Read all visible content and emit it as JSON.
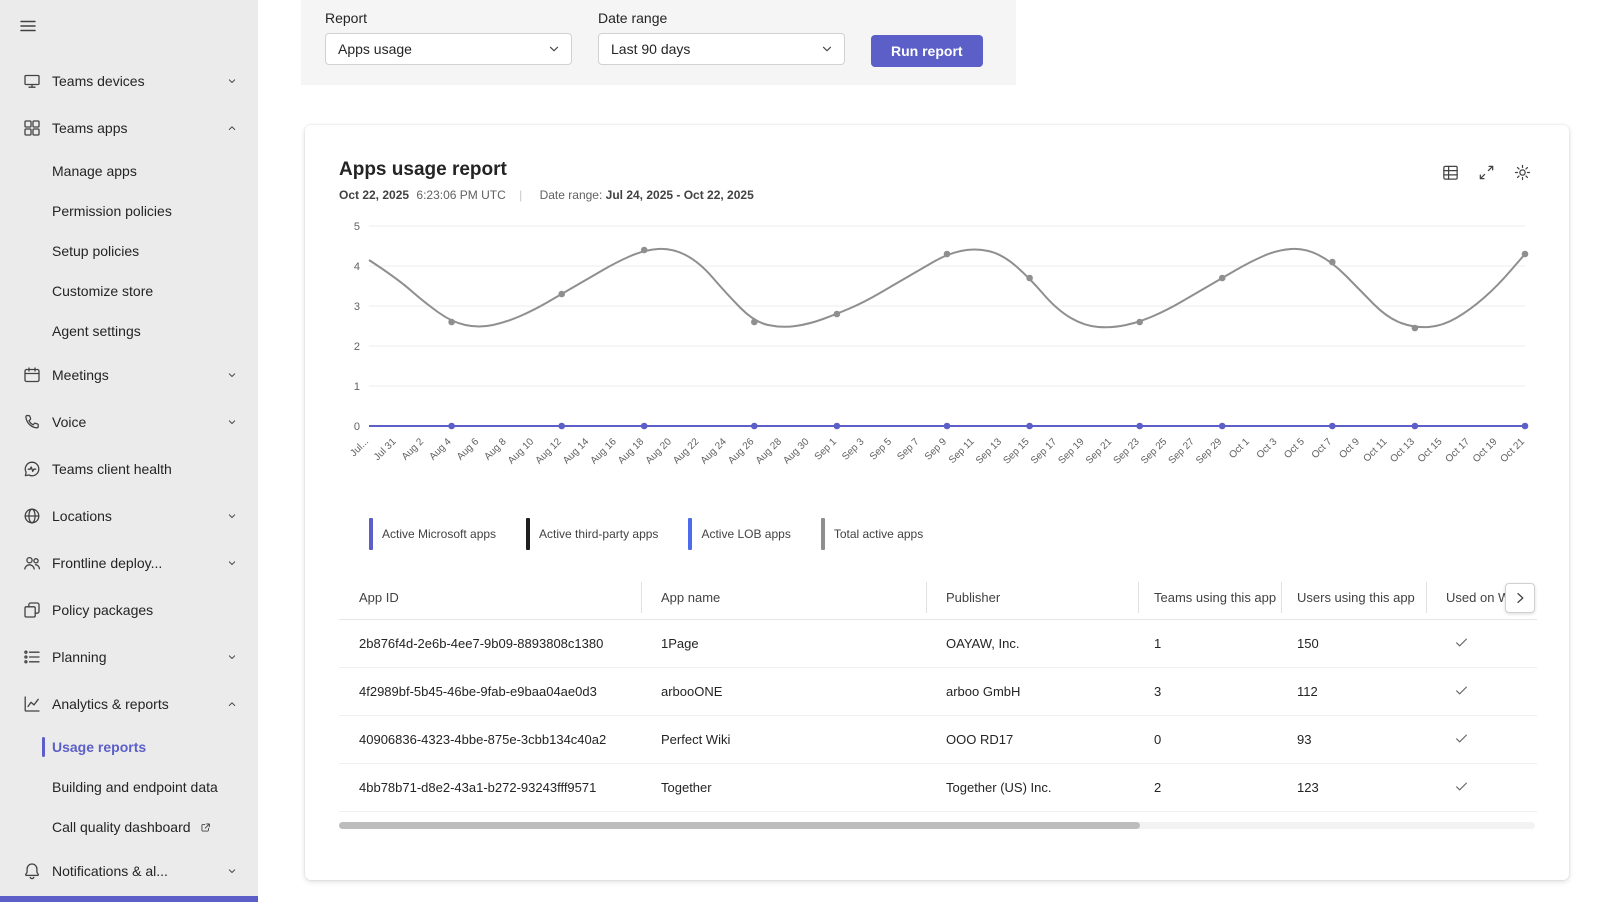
{
  "colors": {
    "accent": "#5b5fc7",
    "sidebar_bg": "#ebebeb",
    "filter_panel_bg": "#f5f5f5",
    "selected_item": "#5b5fc7",
    "scrollbar_thumb": "#bdbdbd"
  },
  "sidebar": {
    "items": [
      {
        "label": "Teams devices",
        "icon": "devices",
        "chevron": "down"
      },
      {
        "label": "Teams apps",
        "icon": "apps",
        "chevron": "up",
        "children": [
          {
            "label": "Manage apps"
          },
          {
            "label": "Permission policies"
          },
          {
            "label": "Setup policies"
          },
          {
            "label": "Customize store"
          },
          {
            "label": "Agent settings"
          }
        ]
      },
      {
        "label": "Meetings",
        "icon": "calendar",
        "chevron": "down"
      },
      {
        "label": "Voice",
        "icon": "phone",
        "chevron": "down"
      },
      {
        "label": "Teams client health",
        "icon": "health"
      },
      {
        "label": "Locations",
        "icon": "globe",
        "chevron": "down"
      },
      {
        "label": "Frontline deploy...",
        "icon": "people",
        "chevron": "down"
      },
      {
        "label": "Policy packages",
        "icon": "packages"
      },
      {
        "label": "Planning",
        "icon": "planning",
        "chevron": "down"
      },
      {
        "label": "Analytics & reports",
        "icon": "analytics",
        "chevron": "up",
        "children": [
          {
            "label": "Usage reports",
            "selected": true
          },
          {
            "label": "Building and endpoint data"
          },
          {
            "label": "Call quality dashboard",
            "external": true
          }
        ]
      },
      {
        "label": "Notifications & al...",
        "icon": "bell",
        "chevron": "down"
      }
    ]
  },
  "filters": {
    "report_label": "Report",
    "report_value": "Apps usage",
    "date_range_label": "Date range",
    "date_range_value": "Last 90 days",
    "run_button_label": "Run report"
  },
  "report": {
    "title": "Apps usage report",
    "generated_date": "Oct 22, 2025",
    "generated_time": "6:23:06 PM UTC",
    "separator": "|",
    "date_range_label": "Date range:",
    "date_range_value": "Jul 24, 2025 - Oct 22, 2025"
  },
  "card": {
    "actions": [
      {
        "name": "export-to-excel",
        "icon": "excel-icon"
      },
      {
        "name": "expand-report",
        "icon": "expand-icon"
      },
      {
        "name": "report-settings",
        "icon": "gear-icon"
      }
    ]
  },
  "chart_data": {
    "type": "line",
    "title": "Apps usage report",
    "xlabel": "",
    "ylabel": "",
    "ylim": [
      0,
      5
    ],
    "y_ticks": [
      0,
      1,
      2,
      3,
      4,
      5
    ],
    "grid": true,
    "legend_position": "bottom",
    "x_labels": [
      "Jul...",
      "Jul 31",
      "Aug 2",
      "Aug 4",
      "Aug 6",
      "Aug 8",
      "Aug 10",
      "Aug 12",
      "Aug 14",
      "Aug 16",
      "Aug 18",
      "Aug 20",
      "Aug 22",
      "Aug 24",
      "Aug 26",
      "Aug 28",
      "Aug 30",
      "Sep 1",
      "Sep 3",
      "Sep 5",
      "Sep 7",
      "Sep 9",
      "Sep 11",
      "Sep 13",
      "Sep 15",
      "Sep 17",
      "Sep 19",
      "Sep 21",
      "Sep 23",
      "Sep 25",
      "Sep 27",
      "Sep 29",
      "Oct 1",
      "Oct 3",
      "Oct 5",
      "Oct 7",
      "Oct 9",
      "Oct 11",
      "Oct 13",
      "Oct 15",
      "Oct 17",
      "Oct 19",
      "Oct 21"
    ],
    "series": [
      {
        "name": "Active Microsoft apps",
        "color": "#5b5fc7",
        "values": [
          0,
          0,
          0,
          0,
          0,
          0,
          0,
          0,
          0,
          0,
          0,
          0,
          0,
          0,
          0,
          0,
          0,
          0,
          0,
          0,
          0,
          0,
          0,
          0,
          0,
          0,
          0,
          0,
          0,
          0,
          0,
          0,
          0,
          0,
          0,
          0,
          0,
          0,
          0,
          0,
          0,
          0,
          0
        ]
      },
      {
        "name": "Active third-party apps",
        "color": "#1f1f1f",
        "values": [
          0,
          0,
          0,
          0,
          0,
          0,
          0,
          0,
          0,
          0,
          0,
          0,
          0,
          0,
          0,
          0,
          0,
          0,
          0,
          0,
          0,
          0,
          0,
          0,
          0,
          0,
          0,
          0,
          0,
          0,
          0,
          0,
          0,
          0,
          0,
          0,
          0,
          0,
          0,
          0,
          0,
          0,
          0
        ]
      },
      {
        "name": "Active LOB apps",
        "color": "#4f6bed",
        "values": [
          0,
          0,
          0,
          0,
          0,
          0,
          0,
          0,
          0,
          0,
          0,
          0,
          0,
          0,
          0,
          0,
          0,
          0,
          0,
          0,
          0,
          0,
          0,
          0,
          0,
          0,
          0,
          0,
          0,
          0,
          0,
          0,
          0,
          0,
          0,
          0,
          0,
          0,
          0,
          0,
          0,
          0,
          0
        ]
      },
      {
        "name": "Total active apps",
        "color": "#8f8f8f",
        "values": [
          4.15,
          3.7,
          3.1,
          2.6,
          2.45,
          2.6,
          2.9,
          3.3,
          3.7,
          4.1,
          4.4,
          4.45,
          4.1,
          3.3,
          2.6,
          2.45,
          2.55,
          2.8,
          3.1,
          3.5,
          3.9,
          4.3,
          4.45,
          4.3,
          3.7,
          2.9,
          2.5,
          2.45,
          2.6,
          2.9,
          3.3,
          3.7,
          4.1,
          4.4,
          4.45,
          4.1,
          3.4,
          2.7,
          2.45,
          2.5,
          2.9,
          3.5,
          4.3
        ]
      }
    ],
    "marker_indices": [
      3,
      7,
      10,
      14,
      17,
      21,
      24,
      28,
      31,
      35,
      38,
      42
    ]
  },
  "table": {
    "columns": [
      "App ID",
      "App name",
      "Publisher",
      "Teams using this app",
      "Users using this app",
      "Used on W"
    ],
    "rows": [
      {
        "app_id": "2b876f4d-2e6b-4ee7-9b09-8893808c1380",
        "app_name": "1Page",
        "publisher": "OAYAW, Inc.",
        "teams_using": "1",
        "users_using": "150",
        "used_on_windows": true
      },
      {
        "app_id": "4f2989bf-5b45-46be-9fab-e9baa04ae0d3",
        "app_name": "arbooONE",
        "publisher": "arboo GmbH",
        "teams_using": "3",
        "users_using": "112",
        "used_on_windows": true
      },
      {
        "app_id": "40906836-4323-4bbe-875e-3cbb134c40a2",
        "app_name": "Perfect Wiki",
        "publisher": "OOO RD17",
        "teams_using": "0",
        "users_using": "93",
        "used_on_windows": true
      },
      {
        "app_id": "4bb78b71-d8e2-43a1-b272-93243fff9571",
        "app_name": "Together",
        "publisher": "Together (US) Inc.",
        "teams_using": "2",
        "users_using": "123",
        "used_on_windows": true
      }
    ]
  }
}
